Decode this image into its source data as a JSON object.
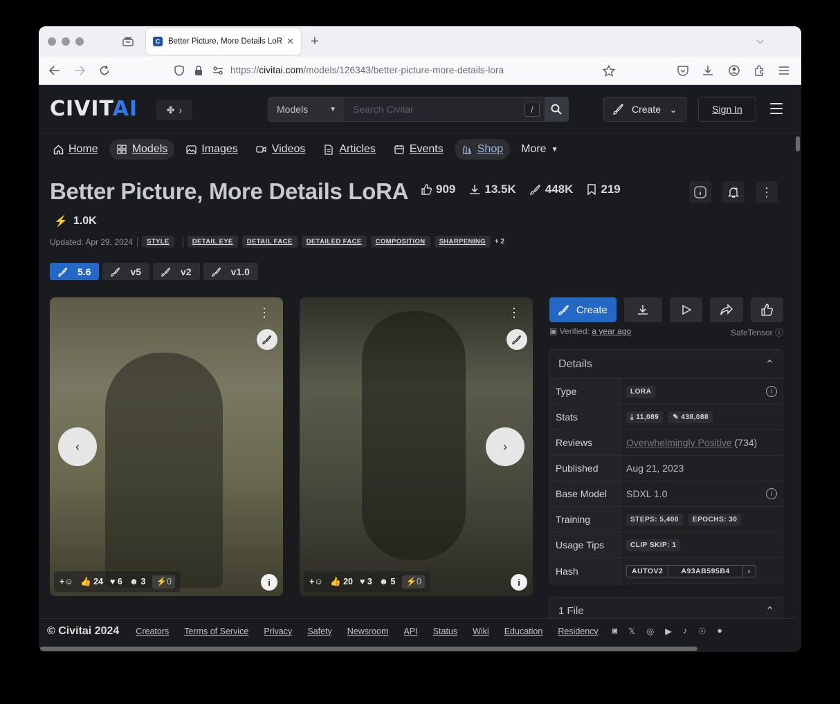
{
  "browser": {
    "tab_title": "Better Picture, More Details LoRA | Stable Diffusion LoRA | Civitai",
    "url_prefix": "https://",
    "url_host": "civitai.com",
    "url_path": "/models/126343/better-picture-more-details-lora"
  },
  "header": {
    "logo_main": "CIVIT",
    "logo_ai": "AI",
    "search_category": "Models",
    "search_placeholder": "Search Civitai",
    "search_shortcut": "/",
    "create_label": "Create",
    "signin_label": "Sign In"
  },
  "nav": {
    "home": "Home",
    "models": "Models",
    "images": "Images",
    "videos": "Videos",
    "articles": "Articles",
    "events": "Events",
    "shop": "Shop",
    "more": "More"
  },
  "model": {
    "title": "Better Picture, More Details LoRA",
    "likes": "909",
    "downloads": "13.5K",
    "generations": "448K",
    "bookmarks": "219",
    "buzz": "1.0K",
    "updated": "Updated: Apr 29, 2024",
    "category_tag": "STYLE",
    "tags": [
      "DETAIL EYE",
      "DETAIL FACE",
      "DETAILED FACE",
      "COMPOSITION",
      "SHARPENING"
    ],
    "tags_more": "+ 2",
    "versions": [
      "5.6",
      "v5",
      "v2",
      "v1.0"
    ]
  },
  "gallery": [
    {
      "likes": "24",
      "hearts": "6",
      "laughs": "3",
      "buzz": "0"
    },
    {
      "likes": "20",
      "hearts": "3",
      "laughs": "5",
      "buzz": "0"
    }
  ],
  "panel": {
    "create_label": "Create",
    "verified_label": "Verified:",
    "verified_time": "a year ago",
    "format": "SafeTensor",
    "details_title": "Details",
    "rows": {
      "type_k": "Type",
      "type_v": "LORA",
      "stats_k": "Stats",
      "stats_downloads": "11,089",
      "stats_generations": "438,088",
      "reviews_k": "Reviews",
      "reviews_v": "Overwhelmingly Positive",
      "reviews_count": "(734)",
      "published_k": "Published",
      "published_v": "Aug 21, 2023",
      "base_k": "Base Model",
      "base_v": "SDXL 1.0",
      "training_k": "Training",
      "training_steps": "STEPS: 5,400",
      "training_epochs": "EPOCHS: 30",
      "usage_k": "Usage Tips",
      "usage_v": "CLIP SKIP: 1",
      "hash_k": "Hash",
      "hash_type": "AUTOV2",
      "hash_value": "A93AB595B4"
    },
    "files_title": "1 File"
  },
  "footer": {
    "copyright": "© Civitai 2024",
    "links": [
      "Creators",
      "Terms of Service",
      "Privacy",
      "Safety",
      "Newsroom",
      "API",
      "Status",
      "Wiki",
      "Education",
      "Residency"
    ]
  }
}
